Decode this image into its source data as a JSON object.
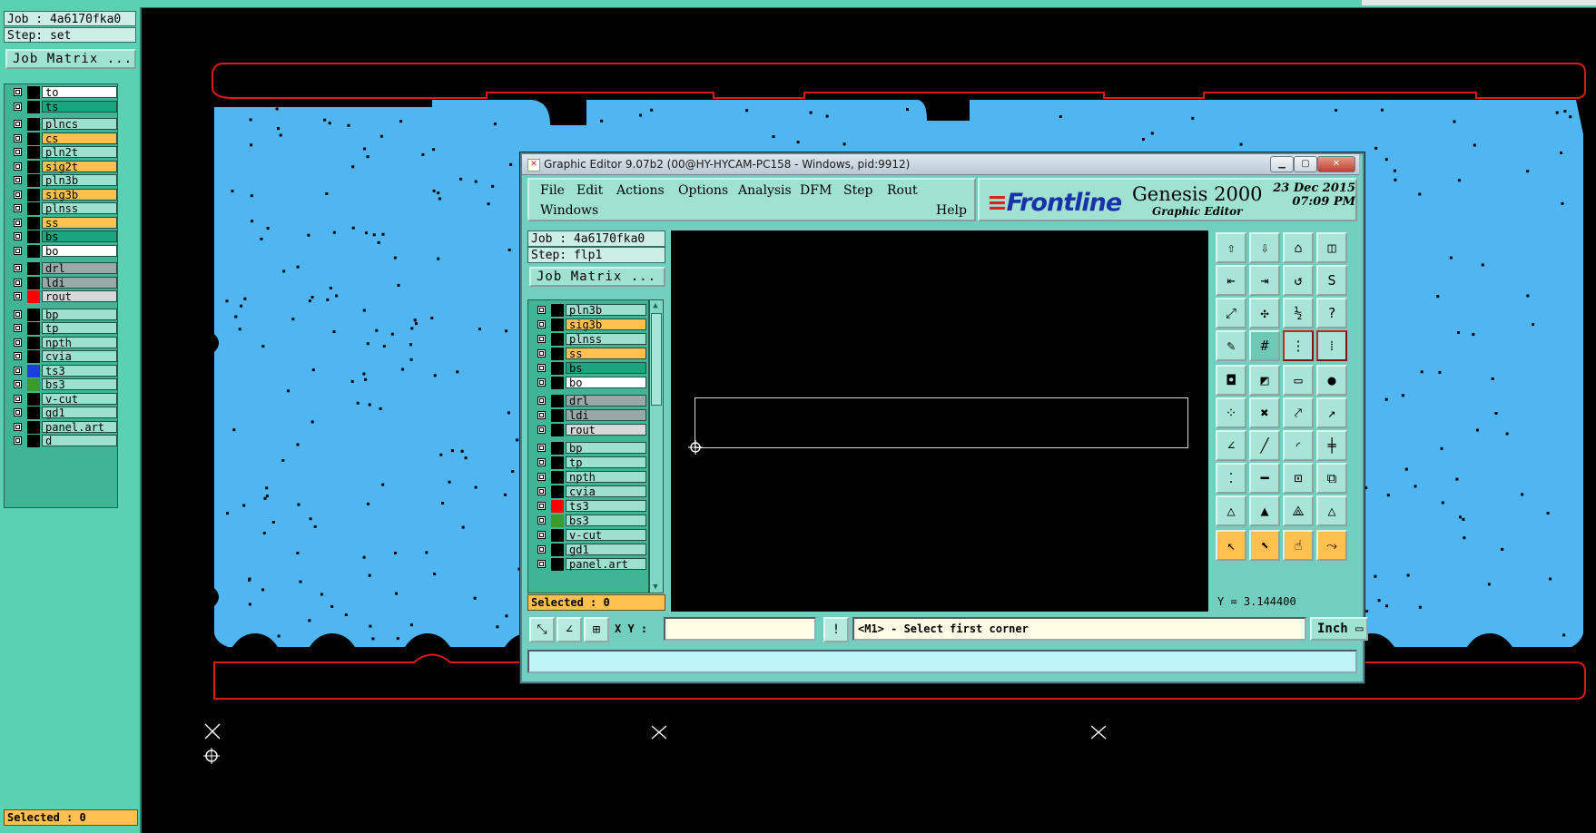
{
  "left_panel": {
    "job": "Job : 4a6170fka0",
    "step": "Step: set",
    "job_matrix": "Job Matrix ...",
    "selected": "Selected : 0",
    "layers": [
      {
        "name": "to",
        "bg": "#ffffff",
        "color": "#000000"
      },
      {
        "name": "ts",
        "bg": "#1aa57e",
        "color": "#000000"
      },
      {
        "name": "plncs",
        "bg": "#9ee0d0",
        "color": "#000000"
      },
      {
        "name": "cs",
        "bg": "#ffc04f",
        "color": "#000000"
      },
      {
        "name": "pln2t",
        "bg": "#9ee0d0",
        "color": "#000000"
      },
      {
        "name": "sig2t",
        "bg": "#ffc04f",
        "color": "#000000"
      },
      {
        "name": "pln3b",
        "bg": "#9ee0d0",
        "color": "#000000"
      },
      {
        "name": "sig3b",
        "bg": "#ffc04f",
        "color": "#000000"
      },
      {
        "name": "plnss",
        "bg": "#9ee0d0",
        "color": "#000000"
      },
      {
        "name": "ss",
        "bg": "#ffc04f",
        "color": "#000000"
      },
      {
        "name": "bs",
        "bg": "#1aa57e",
        "color": "#000000"
      },
      {
        "name": "bo",
        "bg": "#ffffff",
        "color": "#000000"
      },
      {
        "name": "drl",
        "bg": "#9aa8a8",
        "color": "#000000"
      },
      {
        "name": "ldi",
        "bg": "#9aa8a8",
        "color": "#000000"
      },
      {
        "name": "rout",
        "bg": "#d8d8d8",
        "color": "#ff0000"
      },
      {
        "name": "bp",
        "bg": "#9ee0d0",
        "color": "#000000"
      },
      {
        "name": "tp",
        "bg": "#9ee0d0",
        "color": "#000000"
      },
      {
        "name": "npth",
        "bg": "#9ee0d0",
        "color": "#000000"
      },
      {
        "name": "cvia",
        "bg": "#9ee0d0",
        "color": "#000000"
      },
      {
        "name": "ts3",
        "bg": "#9ee0d0",
        "color": "#1a3de0"
      },
      {
        "name": "bs3",
        "bg": "#9ee0d0",
        "color": "#3a9a2a"
      },
      {
        "name": "v-cut",
        "bg": "#9ee0d0",
        "color": "#000000"
      },
      {
        "name": "gd1",
        "bg": "#9ee0d0",
        "color": "#000000"
      },
      {
        "name": "panel.art",
        "bg": "#9ee0d0",
        "color": "#000000"
      },
      {
        "name": "d",
        "bg": "#9ee0d0",
        "color": "#000000"
      }
    ]
  },
  "editor": {
    "title": "Graphic Editor 9.07b2 (00@HY-HYCAM-PC158 - Windows, pid:9912)",
    "menu": [
      "File",
      "Edit",
      "Actions",
      "Options",
      "Analysis",
      "DFM",
      "Step",
      "Rout",
      "Windows",
      "Help"
    ],
    "brand_logo": "Frontline",
    "brand_product": "Genesis 2000",
    "brand_subtitle": "Graphic Editor",
    "date": "23 Dec 2015",
    "time": "07:09 PM",
    "job": "Job : 4a6170fka0",
    "step": "Step: flp1",
    "job_matrix": "Job Matrix ...",
    "selected": "Selected : 0",
    "layers": [
      {
        "name": "pln3b",
        "bg": "#9ee0d0",
        "color": "#000000"
      },
      {
        "name": "sig3b",
        "bg": "#ffc04f",
        "color": "#000000"
      },
      {
        "name": "plnss",
        "bg": "#9ee0d0",
        "color": "#000000"
      },
      {
        "name": "ss",
        "bg": "#ffc04f",
        "color": "#000000"
      },
      {
        "name": "bs",
        "bg": "#1aa57e",
        "color": "#000000"
      },
      {
        "name": "bo",
        "bg": "#ffffff",
        "color": "#000000"
      },
      {
        "name": "drl",
        "bg": "#9aa8a8",
        "color": "#000000"
      },
      {
        "name": "ldi",
        "bg": "#9aa8a8",
        "color": "#000000"
      },
      {
        "name": "rout",
        "bg": "#d8d8d8",
        "color": "#000000"
      },
      {
        "name": "bp",
        "bg": "#9ee0d0",
        "color": "#000000"
      },
      {
        "name": "tp",
        "bg": "#9ee0d0",
        "color": "#000000"
      },
      {
        "name": "npth",
        "bg": "#9ee0d0",
        "color": "#000000"
      },
      {
        "name": "cvia",
        "bg": "#9ee0d0",
        "color": "#000000"
      },
      {
        "name": "ts3",
        "bg": "#9ee0d0",
        "color": "#ff0000"
      },
      {
        "name": "bs3",
        "bg": "#9ee0d0",
        "color": "#3a9a2a"
      },
      {
        "name": "v-cut",
        "bg": "#9ee0d0",
        "color": "#000000"
      },
      {
        "name": "gd1",
        "bg": "#9ee0d0",
        "color": "#000000"
      },
      {
        "name": "panel.art",
        "bg": "#9ee0d0",
        "color": "#000000"
      }
    ],
    "xy_label": "X Y :",
    "xy_value": "",
    "prompt": "<M1> - Select first corner",
    "unit": "Inch",
    "readout": "Y = 3.144400"
  },
  "tools": [
    [
      "open-step-icon",
      "save-icon",
      "home-icon",
      "window-split-icon"
    ],
    [
      "import-icon",
      "export-icon",
      "undo-icon",
      "snap-icon"
    ],
    [
      "zoom-fit-icon",
      "zoom-center-icon",
      "scale-1-2-icon",
      "help-icon"
    ],
    [
      "measure-icon",
      "grid-icon",
      "layer-compare-icon",
      "netlist-icon"
    ],
    [
      "pad-icon",
      "move-icon",
      "ruler-icon",
      "target-icon"
    ],
    [
      "node-icon",
      "cross-icon",
      "connect-icon",
      "arrow-icon"
    ],
    [
      "line-icon",
      "slash-icon",
      "arc-icon",
      "split-icon"
    ],
    [
      "dual-node-icon",
      "minus-icon",
      "box-icon",
      "copy-icon"
    ],
    [
      "triangle-icon",
      "triangle-a-icon",
      "triangle-b-icon",
      "triangle-c-icon"
    ],
    [
      "pointer-icon",
      "pointer-box-icon",
      "pointer-hand-icon",
      "route-icon"
    ]
  ]
}
